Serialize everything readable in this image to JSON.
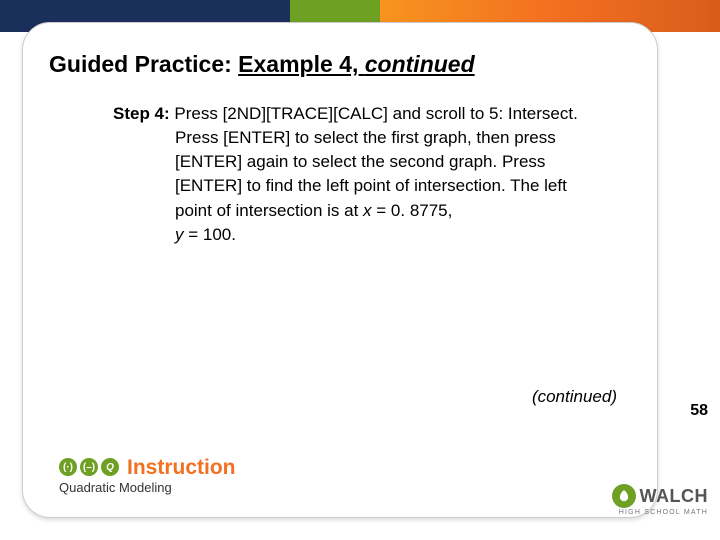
{
  "header": {
    "title_prefix": "Guided Practice: ",
    "title_example": "Example 4, ",
    "title_continued": "continued"
  },
  "body": {
    "step_label": "Step 4:",
    "step_text_1": " Press [2ND][TRACE][CALC] and scroll to 5: Intersect. Press [ENTER] to select the first graph, then press [ENTER] again to select the second graph. Press [ENTER] to find the left point of intersection. The left point of intersection is at ",
    "var_x": "x",
    "eq_x": " = 0. 8775, ",
    "var_y": "y",
    "eq_y": " = 100."
  },
  "continued_label": "(continued)",
  "instruction": {
    "word": "Instruction",
    "subtitle": "Quadratic Modeling",
    "badge1": "(·)",
    "badge2": "(–)",
    "badge3": "Q"
  },
  "page_number": "58",
  "walch": {
    "name": "WALCH",
    "sub": "HIGH SCHOOL MATH"
  }
}
